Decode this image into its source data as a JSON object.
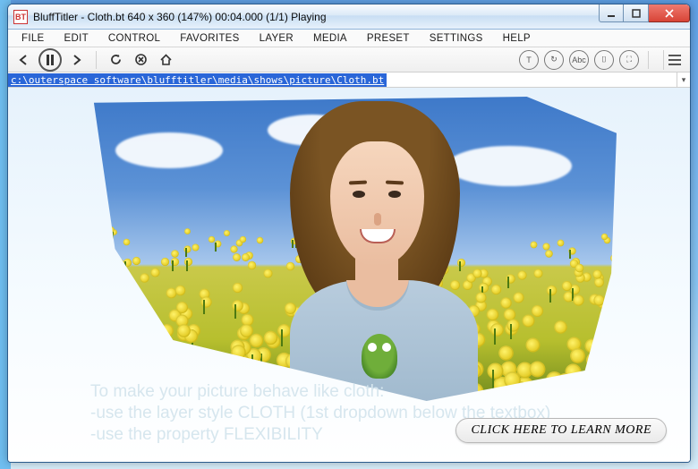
{
  "title": "BluffTitler - Cloth.bt 640 x 360 (147%) 00:04.000 (1/1) Playing",
  "app_icon_text": "BT",
  "menus": [
    "FILE",
    "EDIT",
    "CONTROL",
    "FAVORITES",
    "LAYER",
    "MEDIA",
    "PRESET",
    "SETTINGS",
    "HELP"
  ],
  "path": "c:\\outerspace software\\blufftitler\\media\\shows\\picture\\Cloth.bt",
  "right_tool_labels": {
    "a": "T",
    "b": "↻",
    "c": "Abc",
    "d": "⌷",
    "e": "⛶"
  },
  "hint_lines": [
    "To make your picture behave like cloth:",
    "-use the layer style CLOTH (1st dropdown below the textbox)",
    "-use the property FLEXIBILITY"
  ],
  "learn_more": "CLICK HERE TO LEARN MORE"
}
